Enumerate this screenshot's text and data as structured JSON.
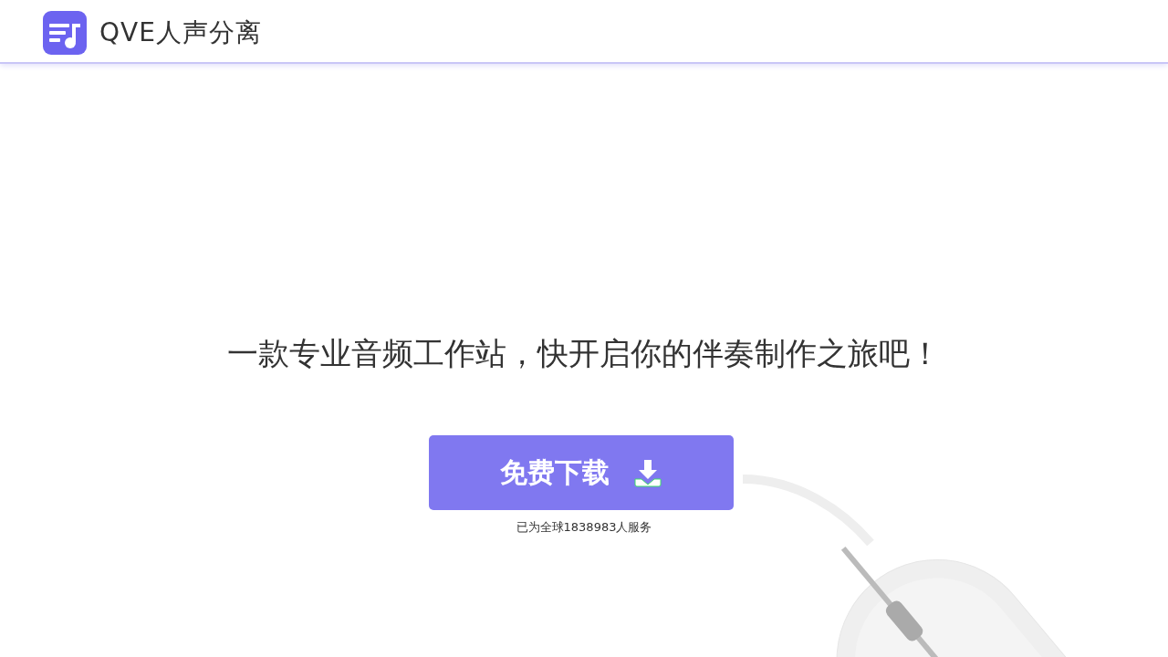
{
  "header": {
    "app_name": "QVE人声分离"
  },
  "hero": {
    "headline": "一款专业音频工作站，快开启你的伴奏制作之旅吧！",
    "download_button": "免费下载",
    "served_count": "已为全球1838983人服务"
  }
}
